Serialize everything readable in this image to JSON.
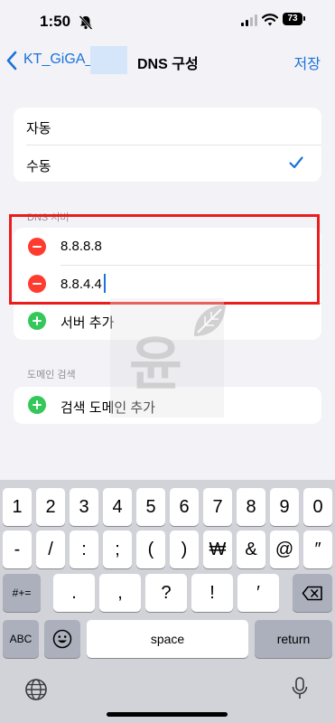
{
  "status_bar": {
    "time": "1:50",
    "battery": "73"
  },
  "nav": {
    "back_label": "KT_GiGA_(",
    "title": "DNS 구성",
    "save_label": "저장"
  },
  "config_options": [
    {
      "label": "자동",
      "selected": false
    },
    {
      "label": "수동",
      "selected": true
    }
  ],
  "dns_section": {
    "header": "DNS 서버",
    "servers": [
      "8.8.8.8",
      "8.8.4.4"
    ],
    "add_label": "서버 추가"
  },
  "domain_section": {
    "header": "도메인 검색",
    "add_label": "검색 도메인 추가"
  },
  "watermark": {
    "text": "윤"
  },
  "keyboard": {
    "row1": [
      "1",
      "2",
      "3",
      "4",
      "5",
      "6",
      "7",
      "8",
      "9",
      "0"
    ],
    "row2": [
      "-",
      "/",
      ":",
      ";",
      "(",
      ")",
      "₩",
      "&",
      "@",
      "″"
    ],
    "row3_left": "#+=",
    "row3": [
      ".",
      ",",
      "?",
      "!",
      "′"
    ],
    "abc": "ABC",
    "space": "space",
    "return": "return"
  },
  "colors": {
    "accent": "#1a73d9",
    "delete": "#ff3b30",
    "add": "#34c759",
    "highlight": "#ea1c1c"
  },
  "icons": [
    "bell-slash-icon",
    "signal-icon",
    "wifi-icon",
    "battery-icon",
    "chevron-left-icon",
    "checkmark-icon",
    "minus-circle-icon",
    "plus-circle-icon",
    "delete-key-icon",
    "emoji-icon",
    "globe-icon",
    "microphone-icon"
  ]
}
